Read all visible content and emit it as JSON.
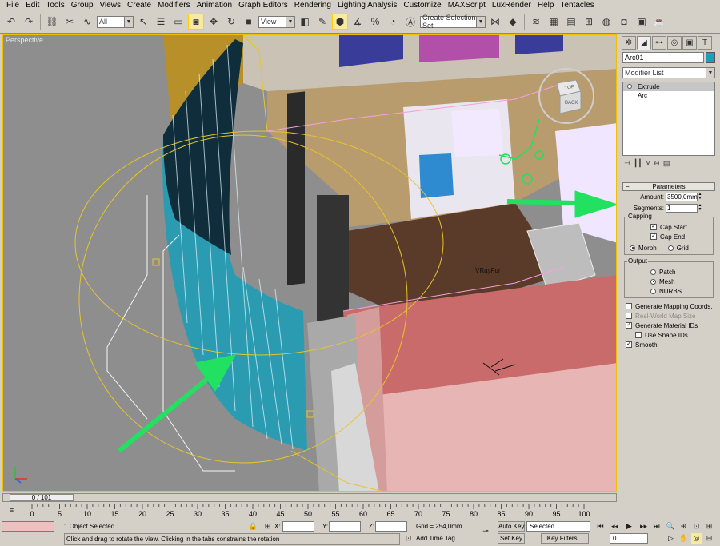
{
  "menu": [
    "File",
    "Edit",
    "Tools",
    "Group",
    "Views",
    "Create",
    "Modifiers",
    "Animation",
    "Graph Editors",
    "Rendering",
    "Lighting Analysis",
    "Customize",
    "MAXScript",
    "LuxRender",
    "Help",
    "Tentacles"
  ],
  "toolbar": {
    "filter_value": "All",
    "refcoord_value": "View",
    "selection_set_placeholder": "Create Selection Set"
  },
  "viewport": {
    "label": "Perspective",
    "viewcube_top": "TOP",
    "viewcube_back": "BACK",
    "scene_label": "VRayFur"
  },
  "command_panel": {
    "object_name": "Arc01",
    "object_color": "#1ea0b4",
    "modifier_list": "Modifier List",
    "stack": [
      {
        "label": "Extrude",
        "selected": true
      },
      {
        "label": "Arc",
        "selected": false
      }
    ],
    "params": {
      "title": "Parameters",
      "amount_label": "Amount:",
      "amount_value": "3500,0mm",
      "segments_label": "Segments:",
      "segments_value": "1",
      "capping_title": "Capping",
      "cap_start": "Cap Start",
      "cap_end": "Cap End",
      "morph": "Morph",
      "grid": "Grid",
      "output_title": "Output",
      "patch": "Patch",
      "mesh": "Mesh",
      "nurbs": "NURBS",
      "gen_mapping": "Generate Mapping Coords.",
      "real_world": "Real-World Map Size",
      "gen_matids": "Generate Material IDs",
      "use_shape_ids": "Use Shape IDs",
      "smooth": "Smooth"
    }
  },
  "timeline": {
    "frame_display": "0 / 101",
    "ticks": [
      "0",
      "5",
      "10",
      "15",
      "20",
      "25",
      "30",
      "35",
      "40",
      "45",
      "50",
      "55",
      "60",
      "65",
      "70",
      "75",
      "80",
      "85",
      "90",
      "95",
      "100"
    ]
  },
  "status": {
    "selection": "1 Object Selected",
    "prompt": "Click and drag to rotate the view.  Clicking in the tabs constrains the rotation",
    "x_label": "X:",
    "y_label": "Y:",
    "z_label": "Z:",
    "grid": "Grid = 254,0mm",
    "add_time_tag": "Add Time Tag",
    "auto_key": "Auto Key",
    "set_key": "Set Key",
    "key_mode": "Selected",
    "key_filters": "Key Filters...",
    "frame": "0"
  },
  "colors": {
    "arrow": "#22e060",
    "wall_teal": "#2a9bb0",
    "pink_wall": "#c96b6b",
    "viewport_bg": "#8e8e8e"
  }
}
